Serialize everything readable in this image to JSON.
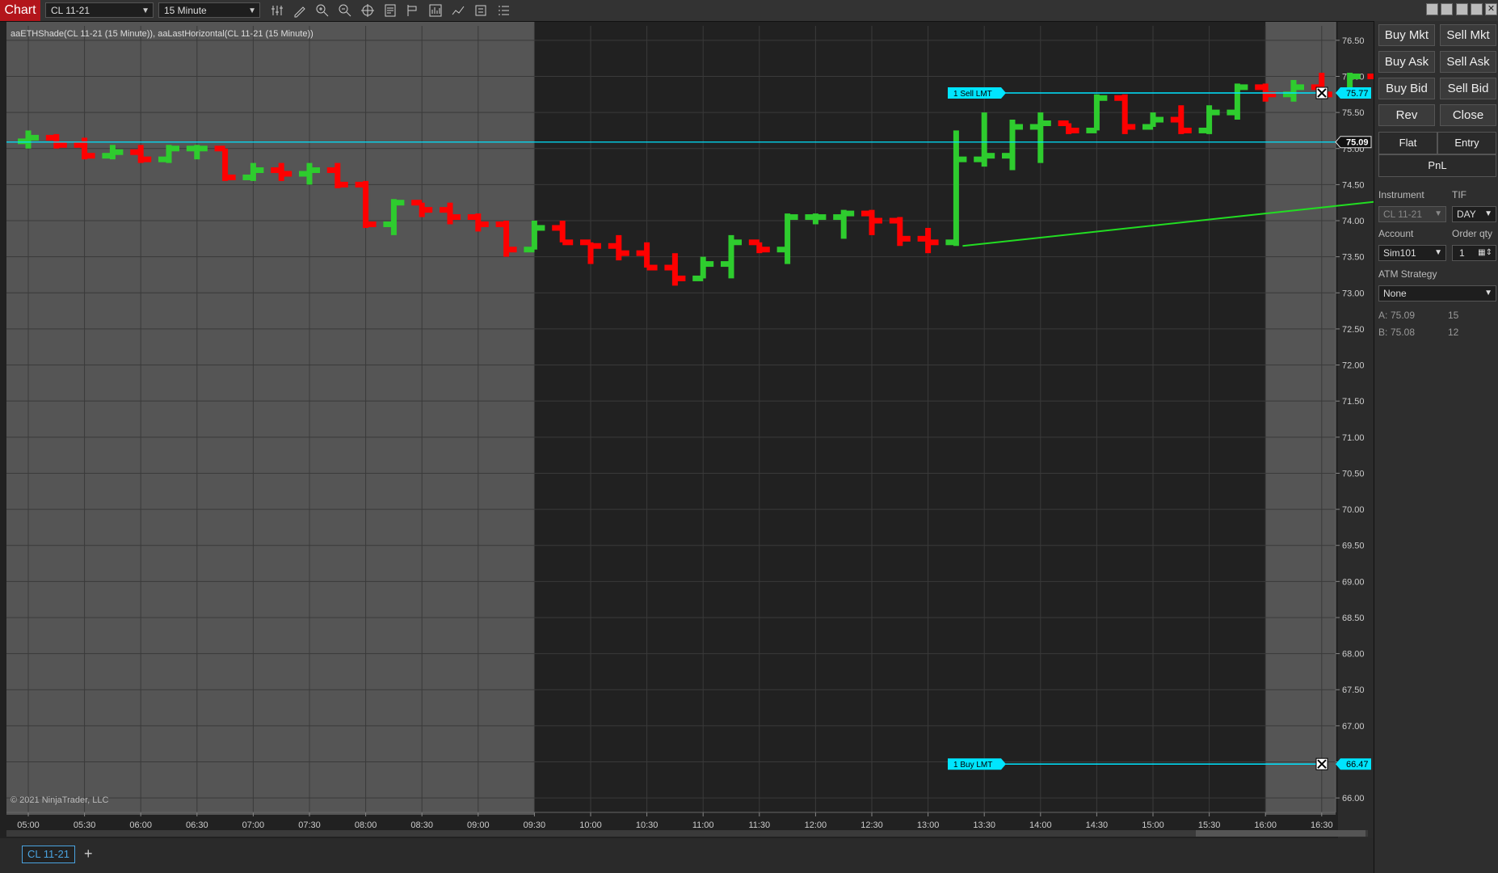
{
  "toolbar": {
    "chart_tab": "Chart",
    "instrument": "CL 11-21",
    "interval": "15 Minute",
    "icons": [
      "data-series-icon",
      "drawing-tool-icon",
      "zoom-in-icon",
      "zoom-out-icon",
      "crosshair-icon",
      "properties-icon",
      "strategies-icon",
      "indicators-icon",
      "chart-trader-icon",
      "templates-icon"
    ]
  },
  "indicator_label": "aaETHShade(CL 11-21 (15 Minute)), aaLastHorizontal(CL 11-21 (15 Minute))",
  "copyright": "© 2021 NinjaTrader, LLC",
  "chart_data": {
    "type": "bar",
    "instrument": "CL 11-21",
    "interval": "15 Minute",
    "y_ticks": [
      "76.50",
      "76.00",
      "75.50",
      "75.00",
      "74.50",
      "74.00",
      "73.50",
      "73.00",
      "72.50",
      "72.00",
      "71.50",
      "71.00",
      "70.50",
      "70.00",
      "69.50",
      "69.00",
      "68.50",
      "68.00",
      "67.50",
      "67.00",
      "66.50",
      "66.00"
    ],
    "ylim": [
      65.8,
      76.7
    ],
    "x_ticks": [
      "05:00",
      "05:30",
      "06:00",
      "06:30",
      "07:00",
      "07:30",
      "08:00",
      "08:30",
      "09:00",
      "09:30",
      "10:00",
      "10:30",
      "11:00",
      "11:30",
      "12:00",
      "12:30",
      "13:00",
      "13:30",
      "14:00",
      "14:30",
      "15:00",
      "15:30",
      "16:00",
      "16:30"
    ],
    "bars_ohlc": [
      [
        75.1,
        75.25,
        75.0,
        75.15
      ],
      [
        75.15,
        75.2,
        75.0,
        75.05
      ],
      [
        75.05,
        75.15,
        74.85,
        74.9
      ],
      [
        74.9,
        75.05,
        74.85,
        74.95
      ],
      [
        74.95,
        75.05,
        74.8,
        74.85
      ],
      [
        74.85,
        75.05,
        74.8,
        75.0
      ],
      [
        75.0,
        75.05,
        74.85,
        75.0
      ],
      [
        75.0,
        75.0,
        74.55,
        74.6
      ],
      [
        74.6,
        74.8,
        74.55,
        74.7
      ],
      [
        74.7,
        74.8,
        74.55,
        74.65
      ],
      [
        74.65,
        74.8,
        74.5,
        74.7
      ],
      [
        74.7,
        74.8,
        74.45,
        74.5
      ],
      [
        74.5,
        74.55,
        73.9,
        73.95
      ],
      [
        73.95,
        74.3,
        73.8,
        74.25
      ],
      [
        74.25,
        74.25,
        74.05,
        74.15
      ],
      [
        74.15,
        74.25,
        73.95,
        74.05
      ],
      [
        74.05,
        74.1,
        73.85,
        73.95
      ],
      [
        73.95,
        74.0,
        73.5,
        73.6
      ],
      [
        73.6,
        74.0,
        73.6,
        73.9
      ],
      [
        73.9,
        74.0,
        73.7,
        73.7
      ],
      [
        73.7,
        73.7,
        73.4,
        73.65
      ],
      [
        73.65,
        73.8,
        73.45,
        73.55
      ],
      [
        73.55,
        73.7,
        73.35,
        73.35
      ],
      [
        73.35,
        73.55,
        73.1,
        73.2
      ],
      [
        73.2,
        73.5,
        73.2,
        73.4
      ],
      [
        73.4,
        73.8,
        73.2,
        73.7
      ],
      [
        73.7,
        73.7,
        73.55,
        73.6
      ],
      [
        73.6,
        74.1,
        73.4,
        74.05
      ],
      [
        74.05,
        74.1,
        73.95,
        74.05
      ],
      [
        74.05,
        74.15,
        73.75,
        74.1
      ],
      [
        74.1,
        74.15,
        73.8,
        74.0
      ],
      [
        74.0,
        74.05,
        73.65,
        73.75
      ],
      [
        73.75,
        73.9,
        73.55,
        73.7
      ],
      [
        73.7,
        75.25,
        73.65,
        74.85
      ],
      [
        74.85,
        75.5,
        74.75,
        74.9
      ],
      [
        74.9,
        75.4,
        74.7,
        75.3
      ],
      [
        75.3,
        75.5,
        74.8,
        75.35
      ],
      [
        75.35,
        75.35,
        75.2,
        75.25
      ],
      [
        75.25,
        75.75,
        75.25,
        75.7
      ],
      [
        75.7,
        75.75,
        75.2,
        75.3
      ],
      [
        75.3,
        75.5,
        75.3,
        75.4
      ],
      [
        75.4,
        75.6,
        75.2,
        75.25
      ],
      [
        75.25,
        75.6,
        75.2,
        75.5
      ],
      [
        75.5,
        75.9,
        75.4,
        75.85
      ],
      [
        75.85,
        75.9,
        75.65,
        75.75
      ],
      [
        75.75,
        75.95,
        75.65,
        75.85
      ],
      [
        75.85,
        76.05,
        75.7,
        75.75
      ],
      [
        75.75,
        76.05,
        75.75,
        76.0
      ],
      [
        76.0,
        76.0,
        74.8,
        75.15
      ],
      [
        75.15,
        75.15,
        75.05,
        75.1
      ],
      [
        75.1,
        75.1,
        74.8,
        74.9
      ],
      [
        74.9,
        75.15,
        74.75,
        74.95
      ],
      [
        74.95,
        75.2,
        74.9,
        75.15
      ],
      [
        75.15,
        75.2,
        75.0,
        75.1
      ],
      [
        75.1,
        75.2,
        74.9,
        75.05
      ],
      [
        75.05,
        75.1,
        74.8,
        75.05
      ],
      [
        75.05,
        75.15,
        74.95,
        15.0
      ],
      [
        75.0,
        75.3,
        74.85,
        75.25
      ],
      [
        75.25,
        75.25,
        75.0,
        75.05
      ],
      [
        75.05,
        75.2,
        74.85,
        74.95
      ],
      [
        74.95,
        75.05,
        74.8,
        74.9
      ],
      [
        74.9,
        75.0,
        74.8,
        74.85
      ],
      [
        74.85,
        75.05,
        74.8,
        74.95
      ],
      [
        74.95,
        75.1,
        74.9,
        75.05
      ],
      [
        75.05,
        75.1,
        74.95,
        75.1
      ],
      [
        75.1,
        75.25,
        74.95,
        75.2
      ],
      [
        75.2,
        75.25,
        74.9,
        74.95
      ],
      [
        74.95,
        75.05,
        74.85,
        74.9
      ],
      [
        74.9,
        75.1,
        74.85,
        75.0
      ],
      [
        75.0,
        75.1,
        74.95,
        75.05
      ],
      [
        75.05,
        75.1,
        75.0,
        75.09
      ]
    ],
    "last_price": "75.09",
    "sell_order": {
      "label": "1 Sell LMT",
      "price": "75.77"
    },
    "buy_order": {
      "label": "1 Buy LMT",
      "price": "66.47"
    },
    "trendline": {
      "from_time": "11:15",
      "from_price": 73.65,
      "to_time": "16:00",
      "to_price": 74.9
    },
    "session_shade": [
      "05:00-09:30",
      "16:00-16:45"
    ],
    "colors": {
      "up": "#2ecc2e",
      "down": "#ff0000",
      "line": "#00e5ff",
      "trend": "#22dd22",
      "shade": "#555555",
      "bg": "#212121"
    },
    "grid": true
  },
  "order_panel": {
    "buttons": [
      "Buy Mkt",
      "Sell Mkt",
      "Buy Ask",
      "Sell Ask",
      "Buy Bid",
      "Sell Bid",
      "Rev",
      "Close"
    ],
    "position_tabs": [
      "Flat",
      "Entry"
    ],
    "pnl": "PnL",
    "instrument_label": "Instrument",
    "instrument_value": "CL 11-21",
    "tif_label": "TIF",
    "tif_value": "DAY",
    "account_label": "Account",
    "account_value": "Sim101",
    "qty_label": "Order qty",
    "qty_value": "1",
    "atm_label": "ATM Strategy",
    "atm_value": "None",
    "ask_label": "A:",
    "ask_price": "75.09",
    "ask_size": "15",
    "bid_label": "B:",
    "bid_price": "75.08",
    "bid_size": "12"
  },
  "bottom": {
    "instrument_tab": "CL 11-21",
    "add_tab": "+"
  }
}
